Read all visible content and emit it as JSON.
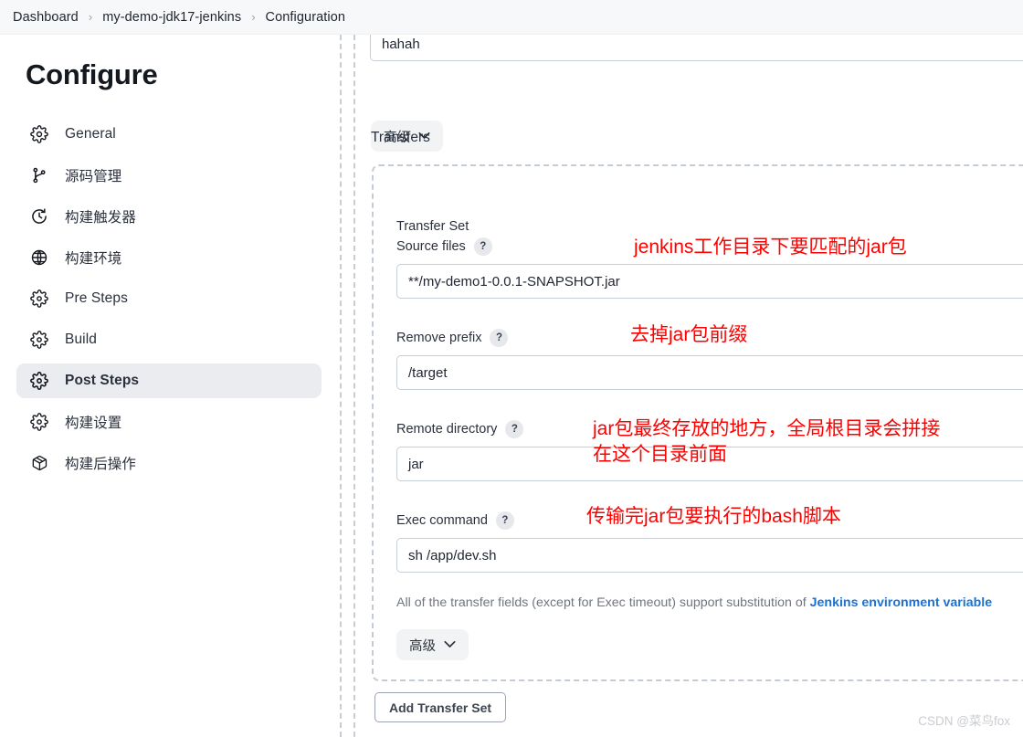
{
  "breadcrumb": {
    "items": [
      "Dashboard",
      "my-demo-jdk17-jenkins",
      "Configuration"
    ],
    "separator": "›"
  },
  "sidebar": {
    "title": "Configure",
    "items": [
      {
        "label": "General",
        "icon": "gear-icon",
        "active": false
      },
      {
        "label": "源码管理",
        "icon": "branch-icon",
        "active": false
      },
      {
        "label": "构建触发器",
        "icon": "clock-icon",
        "active": false
      },
      {
        "label": "构建环境",
        "icon": "globe-icon",
        "active": false
      },
      {
        "label": "Pre Steps",
        "icon": "gear-icon",
        "active": false
      },
      {
        "label": "Build",
        "icon": "gear-icon",
        "active": false
      },
      {
        "label": "Post Steps",
        "icon": "gear-icon",
        "active": true
      },
      {
        "label": "构建设置",
        "icon": "gear-icon",
        "active": false
      },
      {
        "label": "构建后操作",
        "icon": "package-icon",
        "active": false
      }
    ]
  },
  "main": {
    "top_field_value": "hahah",
    "advanced_button_label": "高级",
    "transfers_label": "Transfers",
    "transfer_set_title": "Transfer Set",
    "fields": [
      {
        "label": "Source files",
        "help": "?",
        "value": "**/my-demo1-0.0.1-SNAPSHOT.jar"
      },
      {
        "label": "Remove prefix",
        "help": "?",
        "value": "/target"
      },
      {
        "label": "Remote directory",
        "help": "?",
        "value": "jar"
      },
      {
        "label": "Exec command",
        "help": "?",
        "value": "sh /app/dev.sh"
      }
    ],
    "hint_text": "All of the transfer fields (except for Exec timeout) support substitution of ",
    "hint_link": "Jenkins environment variable",
    "advanced_button_label_2": "高级",
    "add_transfer_set_label": "Add Transfer Set"
  },
  "annotations": [
    {
      "text": "jenkins工作目录下要匹配的jar包"
    },
    {
      "text": "去掉jar包前缀"
    },
    {
      "text": "jar包最终存放的地方，全局根目录会拼接"
    },
    {
      "text": "在这个目录前面"
    },
    {
      "text": "传输完jar包要执行的bash脚本"
    }
  ],
  "watermark": "CSDN @菜鸟fox",
  "colors": {
    "annotation_red": "#ff0000",
    "link_blue": "#1a73d4",
    "active_nav_bg": "#eaecf0",
    "rail_dash": "#c9ccd3"
  }
}
